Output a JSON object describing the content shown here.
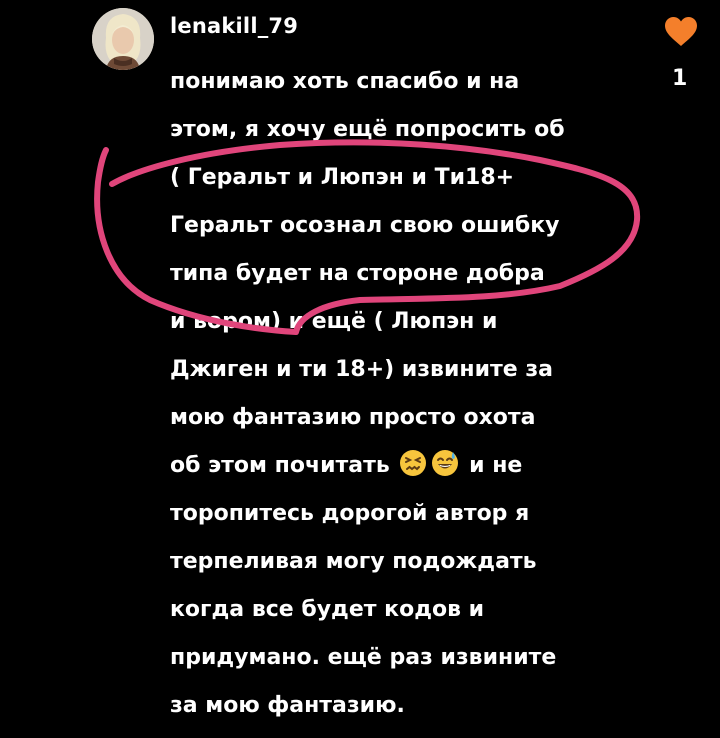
{
  "comment": {
    "username": "lenakill_79",
    "lines": [
      "понимаю хоть спасибо и на",
      "этом, я хочу ещё попросить об",
      "( Геральт и Люпэн и Ти18+",
      "Геральт осознал свою ошибку",
      "типа будет на стороне добра",
      "и вором) и ещё ( Люпэн и",
      "Джиген и ти 18+) извините за",
      "мою фантазию просто охота",
      "об этом почитать",
      "и не",
      "торопитесь дорогой автор я",
      "терпеливая могу подождать",
      "когда все будет кодов и",
      "придумано. ещё раз извините",
      "за мою фантазию."
    ],
    "emojis": [
      "confounded-face-emoji",
      "grinning-sweat-face-emoji"
    ]
  },
  "likes": {
    "count": "1",
    "icon": "heart-icon",
    "color": "#f47f2b"
  },
  "annotation": {
    "color": "#e0457b"
  }
}
